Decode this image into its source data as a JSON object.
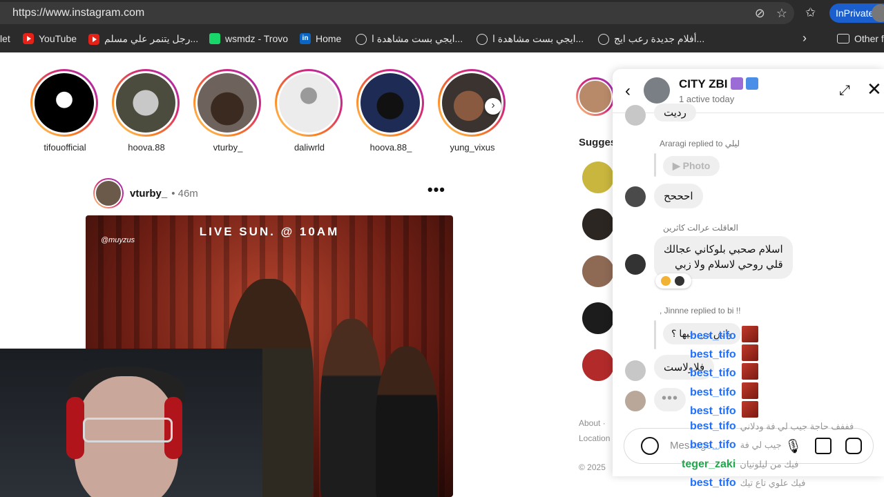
{
  "browser": {
    "url": "https://www.instagram.com",
    "inprivate_label": "InPrivate",
    "bookmarks": [
      {
        "label": "let",
        "icon": "none"
      },
      {
        "label": "YouTube",
        "icon": "youtube-icon"
      },
      {
        "label": "رجل يتنمر علي مسلم...",
        "icon": "youtube-icon"
      },
      {
        "label": "wsmdz - Trovo",
        "icon": "trovo-icon"
      },
      {
        "label": "Home",
        "icon": "linkedin-icon"
      },
      {
        "label": "ايجي بست مشاهدة ا...",
        "icon": "globe-icon"
      },
      {
        "label": "ايجي بست مشاهدة ا...",
        "icon": "globe-icon"
      },
      {
        "label": "أفلام جديدة رعب ايج...",
        "icon": "globe-icon"
      },
      {
        "label": "Other f",
        "icon": "folder-icon"
      }
    ]
  },
  "stories": [
    {
      "name": "tifouofficial"
    },
    {
      "name": "hoova.88"
    },
    {
      "name": "vturby_"
    },
    {
      "name": "daliwrld"
    },
    {
      "name": "hoova.88_"
    },
    {
      "name": "yung_vixus"
    }
  ],
  "post": {
    "username": "vturby_",
    "time": "• 46m",
    "more": "•••",
    "poster_text": "LIVE SUN. @ 10AM",
    "poster_signature": "@muyzus"
  },
  "sidebar": {
    "suggested_label": "Sugges",
    "footer_links": "About · ",
    "footer_location": "Location",
    "copyright": "© 2025"
  },
  "chat": {
    "name": "CITY ZBI",
    "status": "1 active today",
    "messages": {
      "partial_top": "رديت",
      "reply_meta_1": "Araragi replied to ليلي",
      "photo_label": "Photo",
      "msg_1": "احححح",
      "sender_1": "العاقلت عرالت كاثرين",
      "msg_2_line1": "اسلام صحبي بلوكاني عجالك",
      "msg_2_line2": "قلي روحي لاسلام ولا زبي",
      "reply_meta_2": ", Jinnne replied to bi !!",
      "msg_3": "واش من جيها ؟",
      "msg_4": "فلاولاست",
      "typing": "•••"
    },
    "input_placeholder": "Message..."
  },
  "stream_overlay": [
    {
      "user": "best_tifo",
      "msg": ""
    },
    {
      "user": "best_tifo",
      "msg": ""
    },
    {
      "user": "best_tifo",
      "msg": ""
    },
    {
      "user": "best_tifo",
      "msg": ""
    },
    {
      "user": "best_tifo",
      "msg": ""
    },
    {
      "user": "best_tifo",
      "msg": "فففف حاجة جيب لي فة ودلاني"
    },
    {
      "user": "best_tifo",
      "msg": "جيب لي فة"
    },
    {
      "user": "teger_zaki",
      "msg": "فيك من ليلونيان"
    },
    {
      "user": "best_tifo",
      "msg": "فيك علوي تاع تيك"
    }
  ]
}
